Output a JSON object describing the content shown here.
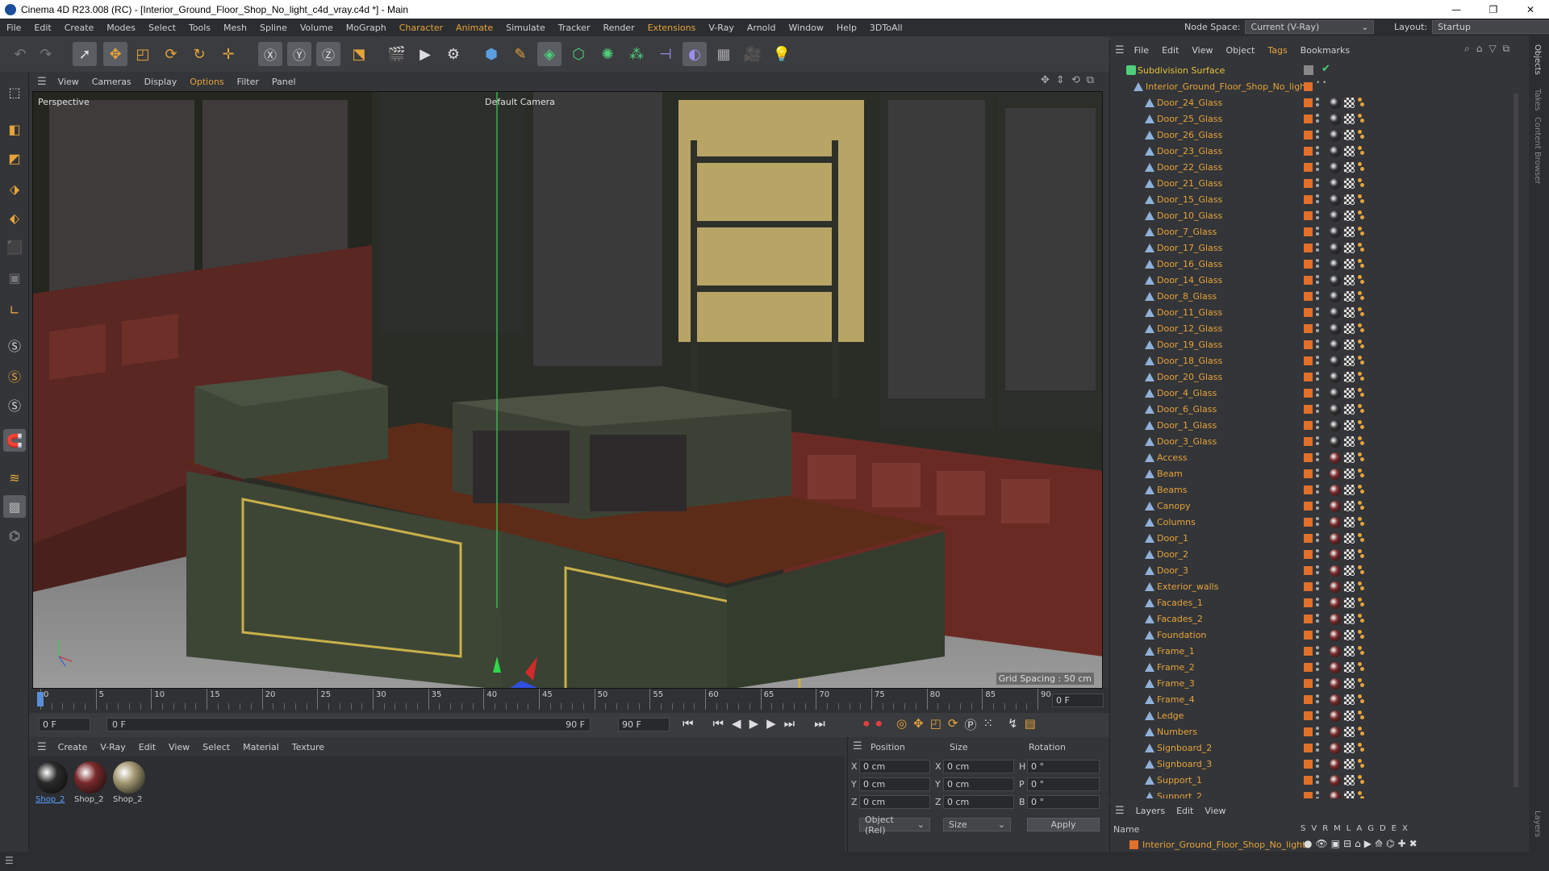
{
  "window": {
    "title": "Cinema 4D R23.008 (RC) - [Interior_Ground_Floor_Shop_No_light_c4d_vray.c4d *] - Main",
    "minimize": "—",
    "maximize": "❐",
    "close": "✕"
  },
  "menubar": {
    "items": [
      "File",
      "Edit",
      "Create",
      "Modes",
      "Select",
      "Tools",
      "Mesh",
      "Spline",
      "Volume",
      "MoGraph",
      "Character",
      "Animate",
      "Simulate",
      "Tracker",
      "Render",
      "Extensions",
      "V-Ray",
      "Arnold",
      "Window",
      "Help",
      "3DToAll"
    ],
    "node_space_label": "Node Space:",
    "node_space_value": "Current (V-Ray)",
    "layout_label": "Layout:",
    "layout_value": "Startup"
  },
  "viewport": {
    "menu": [
      "View",
      "Cameras",
      "Display",
      "Options",
      "Filter",
      "Panel"
    ],
    "view_name": "Perspective",
    "camera": "Default Camera",
    "grid_spacing": "Grid Spacing : 50 cm"
  },
  "timeline": {
    "ticks": [
      "0",
      "5",
      "10",
      "15",
      "20",
      "25",
      "30",
      "35",
      "40",
      "45",
      "50",
      "55",
      "60",
      "65",
      "70",
      "75",
      "80",
      "85",
      "90"
    ],
    "current_frame": "0 F",
    "start_frame": "0 F",
    "range_start": "0 F",
    "range_end": "90 F",
    "end_frame": "90 F"
  },
  "materials": {
    "menu": [
      "Create",
      "V-Ray",
      "Edit",
      "View",
      "Select",
      "Material",
      "Texture"
    ],
    "items": [
      {
        "label": "Shop_2",
        "color": "#2a2a2a"
      },
      {
        "label": "Shop_2",
        "color": "#7a2a2c"
      },
      {
        "label": "Shop_2",
        "color": "#a49a74"
      }
    ]
  },
  "coords": {
    "headers": [
      "Position",
      "Size",
      "Rotation"
    ],
    "rows": [
      {
        "axis": "X",
        "pos": "0 cm",
        "size_axis": "X",
        "size": "0 cm",
        "rot_axis": "H",
        "rot": "0 °"
      },
      {
        "axis": "Y",
        "pos": "0 cm",
        "size_axis": "Y",
        "size": "0 cm",
        "rot_axis": "P",
        "rot": "0 °"
      },
      {
        "axis": "Z",
        "pos": "0 cm",
        "size_axis": "Z",
        "size": "0 cm",
        "rot_axis": "B",
        "rot": "0 °"
      }
    ],
    "mode": "Object (Rel)",
    "size_mode": "Size",
    "apply": "Apply"
  },
  "object_manager": {
    "menu": [
      "File",
      "Edit",
      "View",
      "Object",
      "Tags",
      "Bookmarks"
    ],
    "root": "Subdivision Surface",
    "group": "Interior_Ground_Floor_Shop_No_light",
    "objects": [
      "Door_24_Glass",
      "Door_25_Glass",
      "Door_26_Glass",
      "Door_23_Glass",
      "Door_22_Glass",
      "Door_21_Glass",
      "Door_15_Glass",
      "Door_10_Glass",
      "Door_7_Glass",
      "Door_17_Glass",
      "Door_16_Glass",
      "Door_14_Glass",
      "Door_8_Glass",
      "Door_11_Glass",
      "Door_12_Glass",
      "Door_19_Glass",
      "Door_18_Glass",
      "Door_20_Glass",
      "Door_4_Glass",
      "Door_6_Glass",
      "Door_1_Glass",
      "Door_3_Glass",
      "Access",
      "Beam",
      "Beams",
      "Canopy",
      "Columns",
      "Door_1",
      "Door_2",
      "Door_3",
      "Exterior_walls",
      "Facades_1",
      "Facades_2",
      "Foundation",
      "Frame_1",
      "Frame_2",
      "Frame_3",
      "Frame_4",
      "Ledge",
      "Numbers",
      "Signboard_2",
      "Signboard_3",
      "Support_1",
      "Support_2"
    ]
  },
  "right_tabs": [
    "Objects",
    "Takes",
    "Content Browser",
    "Layers"
  ],
  "layers": {
    "menu": [
      "Layers",
      "Edit",
      "View"
    ],
    "name_header": "Name",
    "cols": [
      "S",
      "V",
      "R",
      "M",
      "L",
      "A",
      "G",
      "D",
      "E",
      "X"
    ],
    "layer_name": "Interior_Ground_Floor_Shop_No_light"
  },
  "colors": {
    "accent": "#e6a33b",
    "layer": "#e0702a"
  }
}
